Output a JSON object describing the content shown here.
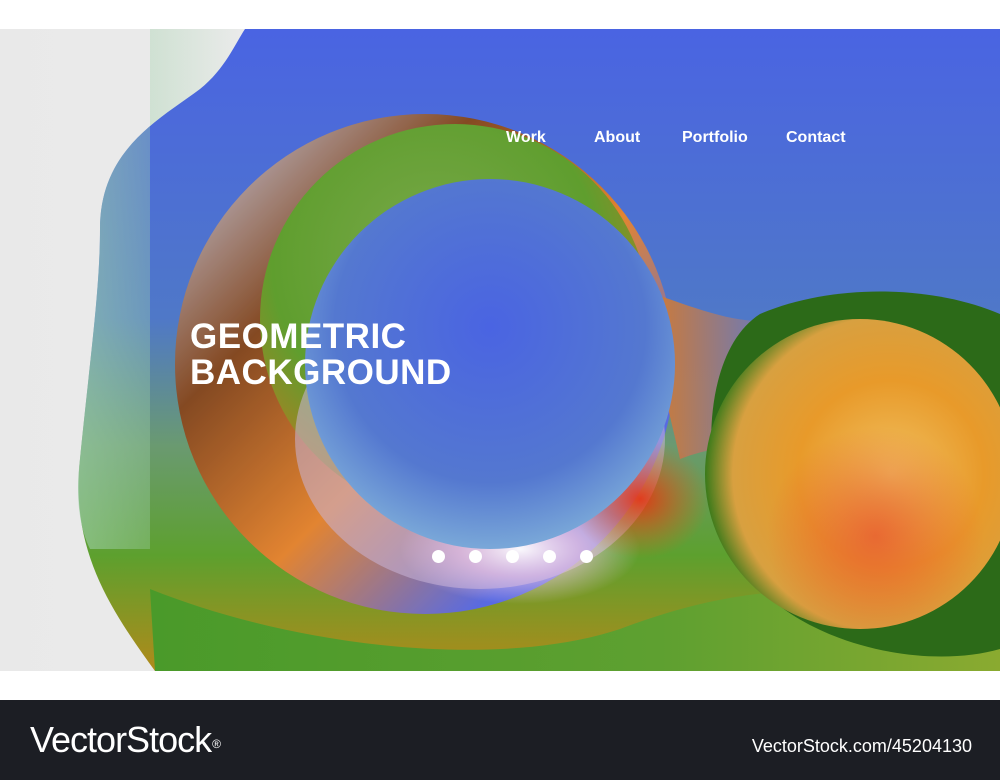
{
  "nav": {
    "items": [
      {
        "label": "Work"
      },
      {
        "label": "About"
      },
      {
        "label": "Portfolio"
      },
      {
        "label": "Contact"
      }
    ]
  },
  "hero": {
    "title_line1": "GEOMETRIC",
    "title_line2": "BACKGROUND"
  },
  "slider": {
    "dot_count": 5,
    "active_index": 0
  },
  "footer": {
    "logo_text": "VectorStock",
    "logo_mark": "®",
    "image_id": "VectorStock.com/45204130"
  },
  "colors": {
    "background_light": "#eeeeee",
    "blue": "#4a64e0",
    "green": "#5a9e2c",
    "orange": "#e8841e",
    "text_white": "#ffffff",
    "footer_dark": "#1c1e24"
  }
}
